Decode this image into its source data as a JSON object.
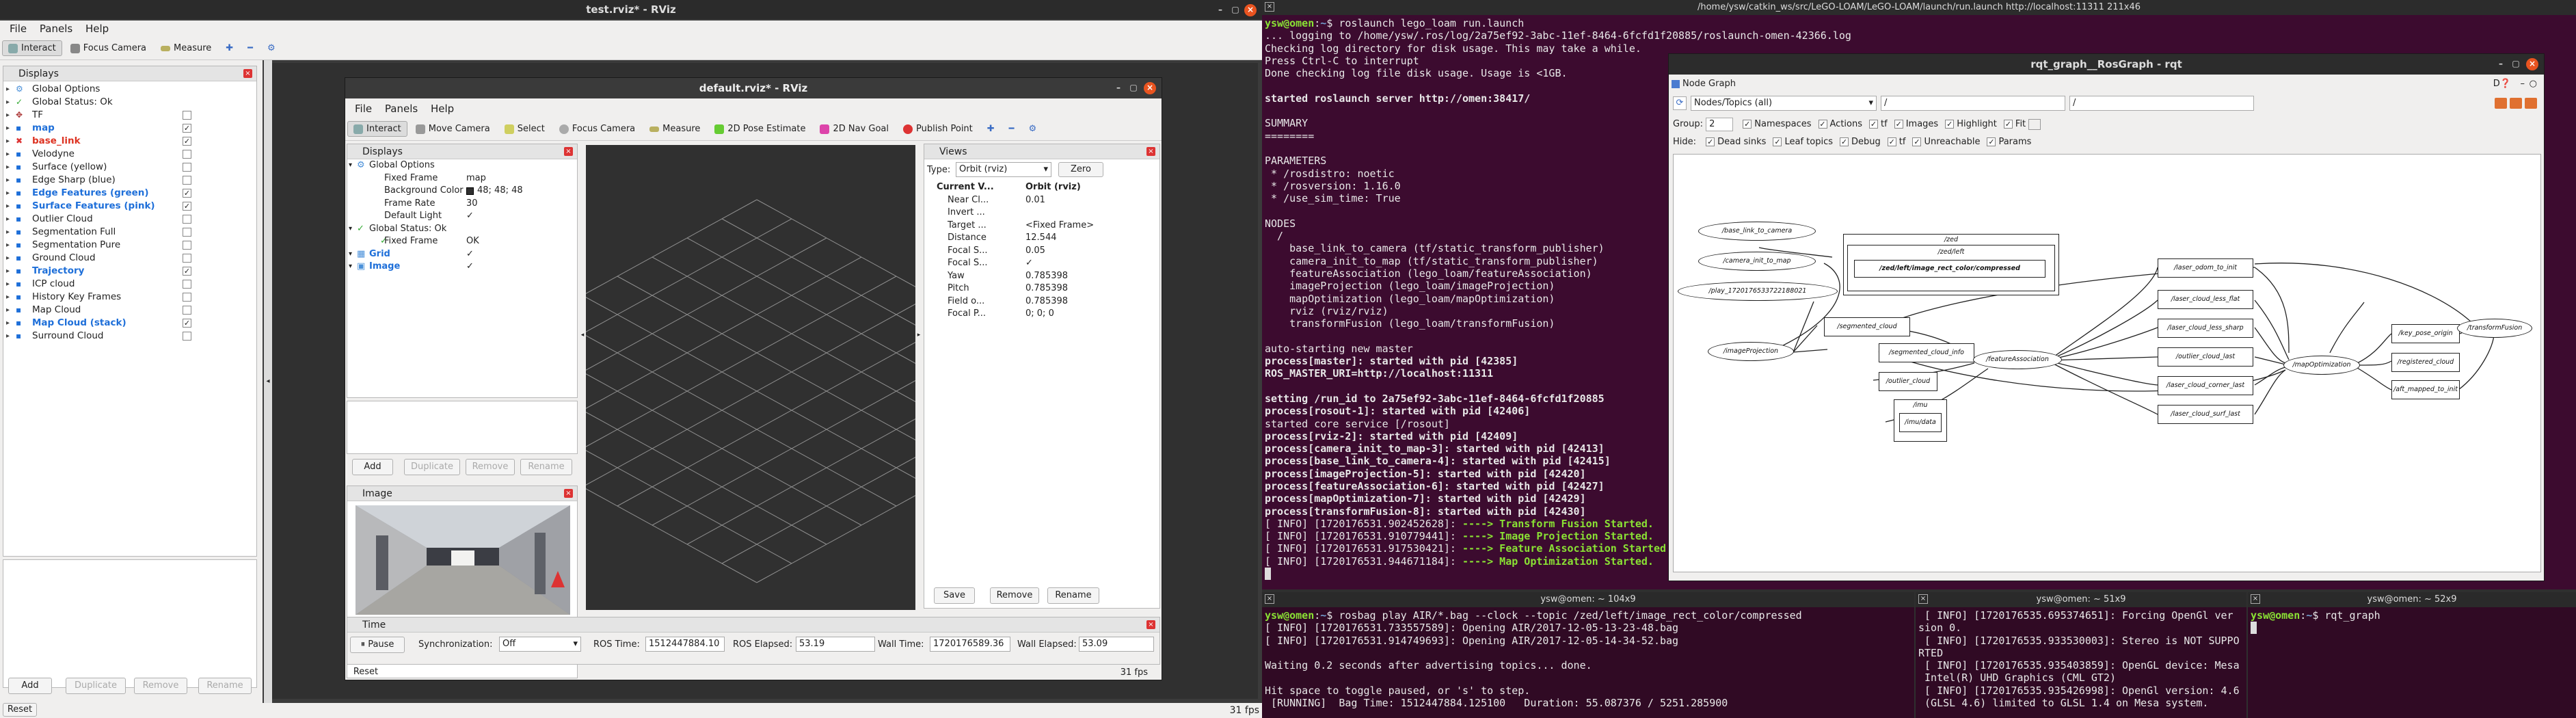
{
  "top_window": {
    "title": "test.rviz* - RViz"
  },
  "menu": [
    "File",
    "Panels",
    "Help"
  ],
  "toolbar": {
    "interact": "Interact",
    "focus_camera": "Focus Camera",
    "measure": "Measure"
  },
  "displays_panel": {
    "title": "Displays",
    "items": [
      {
        "label": "Global Options",
        "icon": "gear-icon",
        "checked": null,
        "style": "normal"
      },
      {
        "label": "Global Status: Ok",
        "icon": "check-icon",
        "checked": null,
        "style": "normal"
      },
      {
        "label": "TF",
        "icon": "tf-icon",
        "checked": false,
        "style": "normal"
      },
      {
        "label": "map",
        "icon": "pointcloud-icon",
        "checked": true,
        "style": "blue"
      },
      {
        "label": "base_link",
        "icon": "error-icon",
        "checked": true,
        "style": "red"
      },
      {
        "label": "Velodyne",
        "icon": "pointcloud-icon",
        "checked": false,
        "style": "normal"
      },
      {
        "label": "Surface (yellow)",
        "icon": "pointcloud-icon",
        "checked": false,
        "style": "normal"
      },
      {
        "label": "Edge Sharp (blue)",
        "icon": "pointcloud-icon",
        "checked": false,
        "style": "normal"
      },
      {
        "label": "Edge Features (green)",
        "icon": "pointcloud-icon",
        "checked": true,
        "style": "blue"
      },
      {
        "label": "Surface Features (pink)",
        "icon": "pointcloud-icon",
        "checked": true,
        "style": "blue"
      },
      {
        "label": "Outlier Cloud",
        "icon": "pointcloud-icon",
        "checked": false,
        "style": "normal"
      },
      {
        "label": "Segmentation Full",
        "icon": "pointcloud-icon",
        "checked": false,
        "style": "normal"
      },
      {
        "label": "Segmentation Pure",
        "icon": "pointcloud-icon",
        "checked": false,
        "style": "normal"
      },
      {
        "label": "Ground Cloud",
        "icon": "pointcloud-icon",
        "checked": false,
        "style": "normal"
      },
      {
        "label": "Trajectory",
        "icon": "pointcloud-icon",
        "checked": true,
        "style": "blue"
      },
      {
        "label": "ICP cloud",
        "icon": "pointcloud-icon",
        "checked": false,
        "style": "normal"
      },
      {
        "label": "History Key Frames",
        "icon": "pointcloud-icon",
        "checked": false,
        "style": "normal"
      },
      {
        "label": "Map Cloud",
        "icon": "pointcloud-icon",
        "checked": false,
        "style": "normal"
      },
      {
        "label": "Map Cloud (stack)",
        "icon": "pointcloud-icon",
        "checked": true,
        "style": "blue"
      },
      {
        "label": "Surround Cloud",
        "icon": "pointcloud-icon",
        "checked": false,
        "style": "normal"
      }
    ],
    "buttons": {
      "add": "Add",
      "duplicate": "Duplicate",
      "remove": "Remove",
      "rename": "Rename"
    }
  },
  "reset_label": "Reset",
  "fps_outer": "31 fps",
  "inner_window": {
    "title": "default.rviz* - RViz",
    "toolbar": {
      "interact": "Interact",
      "move_camera": "Move Camera",
      "select": "Select",
      "focus_camera": "Focus Camera",
      "measure": "Measure",
      "pose_estimate": "2D Pose Estimate",
      "nav_goal": "2D Nav Goal",
      "publish_point": "Publish Point"
    },
    "displays": {
      "title": "Displays",
      "rows": [
        {
          "label": "Global Options",
          "value": "",
          "indent": 0,
          "icon": "gear-icon"
        },
        {
          "label": "Fixed Frame",
          "value": "map",
          "indent": 1,
          "icon": ""
        },
        {
          "label": "Background Color",
          "value": "48; 48; 48",
          "indent": 1,
          "icon": ""
        },
        {
          "label": "Frame Rate",
          "value": "30",
          "indent": 1,
          "icon": ""
        },
        {
          "label": "Default Light",
          "value": "✓",
          "indent": 1,
          "icon": ""
        },
        {
          "label": "Global Status: Ok",
          "value": "",
          "indent": 0,
          "icon": "check-icon"
        },
        {
          "label": "Fixed Frame",
          "value": "OK",
          "indent": 1,
          "icon": "check-icon"
        },
        {
          "label": "Grid",
          "value": "✓",
          "indent": 0,
          "icon": "grid-icon"
        },
        {
          "label": "Image",
          "value": "✓",
          "indent": 0,
          "icon": "image-icon"
        }
      ],
      "buttons": {
        "add": "Add",
        "duplicate": "Duplicate",
        "remove": "Remove",
        "rename": "Rename"
      }
    },
    "image_panel": {
      "title": "Image"
    },
    "views": {
      "title": "Views",
      "type_label": "Type:",
      "type_value": "Orbit (rviz)",
      "zero": "Zero",
      "rows": [
        {
          "label": "Current V...",
          "value": "Orbit (rviz)"
        },
        {
          "label": "Near Cl...",
          "value": "0.01"
        },
        {
          "label": "Invert ...",
          "value": ""
        },
        {
          "label": "Target ...",
          "value": "<Fixed Frame>"
        },
        {
          "label": "Distance",
          "value": "12.544"
        },
        {
          "label": "Focal S...",
          "value": "0.05"
        },
        {
          "label": "Focal S...",
          "value": "✓"
        },
        {
          "label": "Yaw",
          "value": "0.785398"
        },
        {
          "label": "Pitch",
          "value": "0.785398"
        },
        {
          "label": "Field o...",
          "value": "0.785398"
        },
        {
          "label": "Focal P...",
          "value": "0; 0; 0"
        }
      ],
      "buttons": {
        "save": "Save",
        "remove": "Remove",
        "rename": "Rename"
      }
    },
    "time": {
      "title": "Time",
      "pause": "Pause",
      "sync_label": "Synchronization:",
      "sync_value": "Off",
      "ros_time_label": "ROS Time:",
      "ros_time": "1512447884.10",
      "ros_elapsed_label": "ROS Elapsed:",
      "ros_elapsed": "53.19",
      "wall_time_label": "Wall Time:",
      "wall_time": "1720176589.36",
      "wall_elapsed_label": "Wall Elapsed:",
      "wall_elapsed": "53.09"
    },
    "reset": "Reset",
    "fps": "31 fps"
  },
  "terminal_main": {
    "title": "/home/ysw/catkin_ws/src/LeGO-LOAM/LeGO-LOAM/launch/run.launch http://localhost:11311 211x46"
  },
  "rqt": {
    "title": "rqt_graph__RosGraph - rqt",
    "plugin_title": "Node Graph",
    "mode": "Nodes/Topics (all)",
    "filter1": "/",
    "filter2": "/",
    "group_label": "Group:",
    "group_value": "2",
    "options_row1": [
      "Namespaces",
      "Actions",
      "tf",
      "Images",
      "Highlight",
      "Fit"
    ],
    "hide_label": "Hide:",
    "options_row2": [
      "Dead sinks",
      "Leaf topics",
      "Debug",
      "tf",
      "Unreachable",
      "Params"
    ]
  },
  "graph": {
    "nodes": [
      "/base_link_to_camera",
      "/camera_init_to_map",
      "/play_1720176533722188021",
      "/imageProjection",
      "/featureAssociation",
      "/mapOptimization",
      "/transformFusion"
    ],
    "topics": [
      "/zed",
      "/zed/left",
      "/zed/left/image_rect_color/compressed",
      "/segmented_cloud",
      "/segmented_cloud_info",
      "/outlier_cloud",
      "/imu",
      "/imu/data",
      "/laser_odom_to_init",
      "/laser_cloud_less_flat",
      "/laser_cloud_less_sharp",
      "/outlier_cloud_last",
      "/laser_cloud_corner_last",
      "/laser_cloud_surf_last",
      "/key_pose_origin",
      "/registered_cloud",
      "/aft_mapped_to_init"
    ]
  },
  "term_bl": {
    "title": "ysw@omen: ~ 104x9"
  },
  "term_bm": {
    "title": "ysw@omen: ~ 51x9"
  },
  "term_br": {
    "title": "ysw@omen: ~ 52x9"
  }
}
